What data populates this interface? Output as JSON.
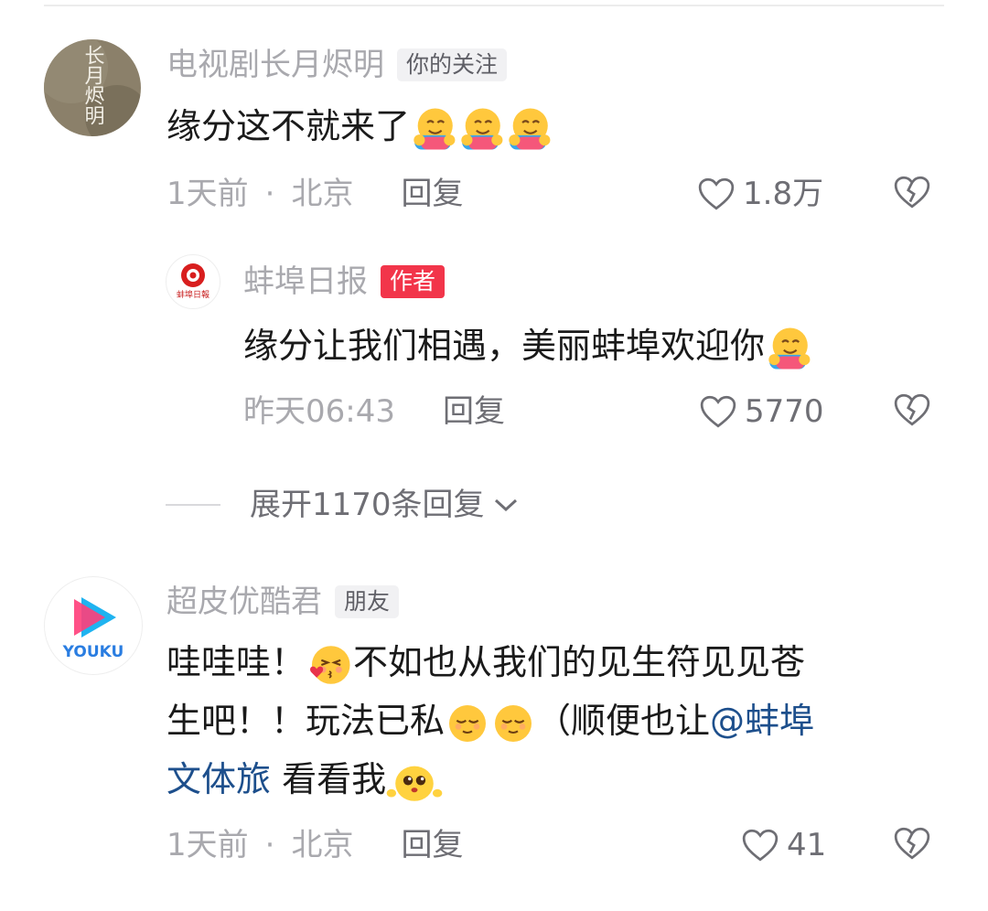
{
  "comments": [
    {
      "username": "电视剧长月烬明",
      "tag": "你的关注",
      "avatar_text": "长月烬明",
      "text": "缘分这不就来了",
      "emojis": [
        "hugging-face",
        "hugging-face",
        "hugging-face"
      ],
      "time": "1天前",
      "location": "北京",
      "reply_label": "回复",
      "likes": "1.8万",
      "reply": {
        "username": "蚌埠日报",
        "tag": "作者",
        "avatar_text": "蚌埠日報",
        "text": "缘分让我们相遇，美丽蚌埠欢迎你",
        "emojis": [
          "hugging-face"
        ],
        "time": "昨天06:43",
        "reply_label": "回复",
        "likes": "5770"
      },
      "expand_label": "展开1170条回复"
    },
    {
      "username": "超皮优酷君",
      "tag": "朋友",
      "avatar_text": "YOUKU",
      "text_parts": {
        "line1_a": "哇哇哇！",
        "line1_b": "不如也从我们的见生符见见苍",
        "line2_a": "生吧！！玩法已私",
        "line2_b": "（顺便也让",
        "mention_a": "@蚌埠",
        "mention_b": "文体旅",
        "line3_b": " 看看我"
      },
      "emojis": [
        "kissing-face",
        "relieved-face",
        "relieved-face",
        "pleading-face"
      ],
      "time": "1天前",
      "location": "北京",
      "reply_label": "回复",
      "likes": "41"
    }
  ],
  "colors": {
    "muted_text": "#a9a9ae",
    "author_tag": "#f2354a",
    "mention": "#1d4f8c",
    "body_text": "#1a1a1a"
  }
}
